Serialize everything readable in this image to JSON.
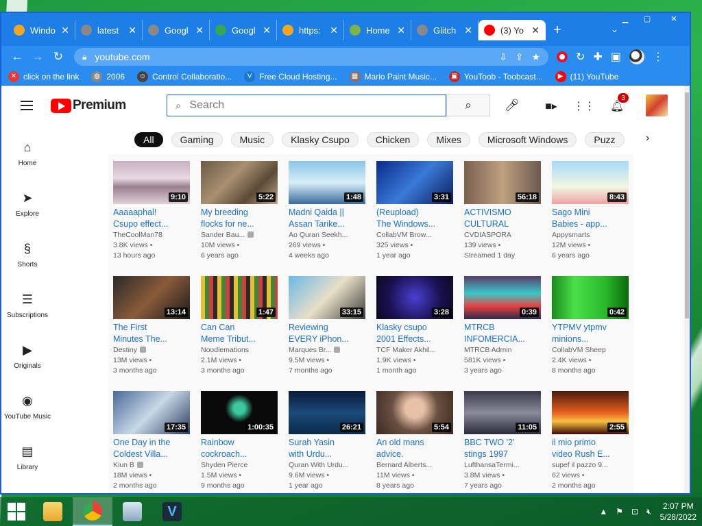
{
  "browser": {
    "tabs": [
      {
        "label": "Windo",
        "fav_color": "#f5a623",
        "active": false
      },
      {
        "label": "latest",
        "fav_color": "#888888",
        "active": false
      },
      {
        "label": "Googl",
        "fav_color": "#888888",
        "active": false
      },
      {
        "label": "Googl",
        "fav_color": "#34a853",
        "active": false
      },
      {
        "label": "https:",
        "fav_color": "#f5a623",
        "active": false
      },
      {
        "label": "Home",
        "fav_color": "#7cb342",
        "active": false
      },
      {
        "label": "Glitch",
        "fav_color": "#888888",
        "active": false
      },
      {
        "label": "(3) Yo",
        "fav_color": "#ff0000",
        "active": true
      }
    ],
    "new_tab": "+",
    "tab_menu": "⌄",
    "url": "youtube.com",
    "bookmarks": [
      {
        "label": "click on the link",
        "icon_color": "#e53935",
        "icon": "✕"
      },
      {
        "label": "2006",
        "icon_color": "#888888",
        "icon": "◍"
      },
      {
        "label": "Control Collaboratio...",
        "icon_color": "#444444",
        "icon": "☺"
      },
      {
        "label": "Free Cloud Hosting...",
        "icon_color": "#1976d2",
        "icon": "V"
      },
      {
        "label": "Mario Paint Music...",
        "icon_color": "#8d6e63",
        "icon": "▦"
      },
      {
        "label": "YouToob - Toobcast...",
        "icon_color": "#c62828",
        "icon": "▣"
      },
      {
        "label": "(11) YouTube",
        "icon_color": "#ff0000",
        "icon": "▶"
      }
    ]
  },
  "yt": {
    "logo_word": "Premium",
    "search_placeholder": "Search",
    "notifications": "3",
    "chips": [
      "All",
      "Gaming",
      "Music",
      "Klasky Csupo",
      "Chicken",
      "Mixes",
      "Microsoft Windows",
      "Puzz"
    ],
    "sidebar": [
      {
        "label": "Home",
        "icon": "⌂"
      },
      {
        "label": "Explore",
        "icon": "➤"
      },
      {
        "label": "Shorts",
        "icon": "§"
      },
      {
        "label": "Subscriptions",
        "icon": "☰"
      },
      {
        "label": "Originals",
        "icon": "▶"
      },
      {
        "label": "YouTube Music",
        "icon": "◉"
      },
      {
        "label": "Library",
        "icon": "▤"
      }
    ],
    "videos": [
      {
        "t1": "Aaaaaphal!",
        "t2": "Csupo effect...",
        "ch": "TheCoolMan78",
        "v": false,
        "views": "3.8K views •",
        "age": "13 hours ago",
        "dur": "9:10",
        "bg": "linear-gradient(180deg,#c8b0c0,#e8d8e0 40%,#9a8090 60%,#e0d0d8)"
      },
      {
        "t1": "My breeding",
        "t2": "flocks for ne...",
        "ch": "Sander Bau...",
        "v": true,
        "views": "10M views •",
        "age": "6 years ago",
        "dur": "5:22",
        "bg": "linear-gradient(135deg,#6b5a48,#a89070 40%,#5a4a38 70%,#c0a888)"
      },
      {
        "t1": "Madni Qaida ||",
        "t2": "Assan Tarike...",
        "ch": "Ao Quran Seekh...",
        "v": false,
        "views": "269 views •",
        "age": "4 weeks ago",
        "dur": "1:48",
        "bg": "linear-gradient(180deg,#8ac4e8,#d8eef8 50%,#3a6a9a)"
      },
      {
        "t1": "(Reupload)",
        "t2": "The Windows...",
        "ch": "CollabVM Brow...",
        "v": false,
        "views": "325 views •",
        "age": "1 year ago",
        "dur": "3:31",
        "bg": "linear-gradient(135deg,#0a2a8a,#3a7ad8 50%,#0a1a5a)"
      },
      {
        "t1": "ACTIVISMO",
        "t2": "CULTURAL",
        "ch": "CVDIASPORA",
        "v": false,
        "views": "139 views •",
        "age": "Streamed 1 day",
        "dur": "56:18",
        "bg": "linear-gradient(90deg,#7a6050,#c0a080 50%,#6a5a50)"
      },
      {
        "t1": "Sago Mini",
        "t2": "Babies - app...",
        "ch": "Appysmarts",
        "v": false,
        "views": "12M views •",
        "age": "6 years ago",
        "dur": "8:43",
        "bg": "linear-gradient(180deg,#a8d8f8,#f0f8e0 60%,#f0a0a0)"
      },
      {
        "t1": "The First",
        "t2": "Minutes The...",
        "ch": "Destiny",
        "v": true,
        "views": "13M views •",
        "age": "3 months ago",
        "dur": "13:14",
        "bg": "linear-gradient(135deg,#2a2a2a,#8a5a3a 50%,#1a1a1a)"
      },
      {
        "t1": "Can Can",
        "t2": "Meme Tribut...",
        "ch": "Noodlemations",
        "v": false,
        "views": "2.1M views •",
        "age": "3 months ago",
        "dur": "1:47",
        "bg": "repeating-linear-gradient(90deg,#e8c030 0 6px,#3a8a3a 6px 12px,#d04040 12px 18px,#2a2a2a 18px 24px)"
      },
      {
        "t1": "Reviewing",
        "t2": "EVERY iPhon...",
        "ch": "Marques Br...",
        "v": true,
        "views": "9.5M views •",
        "age": "7 months ago",
        "dur": "33:15",
        "bg": "linear-gradient(135deg,#6ab8e8,#e8e0c8 50%,#3a3a3a)"
      },
      {
        "t1": "Klasky csupo",
        "t2": "2001 Effects...",
        "ch": "TCF Maker Akhil...",
        "v": false,
        "views": "1.9K views •",
        "age": "1 month ago",
        "dur": "3:28",
        "bg": "radial-gradient(circle,#4a40d0,#1a1050 60%,#0a0a20)"
      },
      {
        "t1": "MTRCB",
        "t2": "INFOMERCIA...",
        "ch": "MTRCB Admin",
        "v": false,
        "views": "581K views •",
        "age": "3 years ago",
        "dur": "0:39",
        "bg": "linear-gradient(180deg,#5a3a6a,#3ac8c8 40%,#e84040 70%,#2a2a4a)"
      },
      {
        "t1": "YTPMV ytpmv",
        "t2": "minions...",
        "ch": "CollabVM Sheep",
        "v": false,
        "views": "2.4K views •",
        "age": "8 months ago",
        "dur": "0:42",
        "bg": "linear-gradient(90deg,#1a8a1a,#4ae04a 30%,#2ab82a 70%,#0a6a0a)"
      },
      {
        "t1": "One Day in the",
        "t2": "Coldest Villa...",
        "ch": "Kiun B",
        "v": true,
        "views": "18M views •",
        "age": "2 months ago",
        "dur": "17:35",
        "bg": "linear-gradient(135deg,#4a6a9a,#c8d8e8 50%,#2a3a5a)"
      },
      {
        "t1": "Rainbow",
        "t2": "cockroach...",
        "ch": "Shyden Pierce",
        "v": false,
        "views": "1.5M views •",
        "age": "9 months ago",
        "dur": "1:00:35",
        "bg": "radial-gradient(circle at 50% 40%,#3ac8a0 0 12%,#0a0a0a 30%)"
      },
      {
        "t1": "Surah Yasin",
        "t2": "with Urdu...",
        "ch": "Quran With Urdu...",
        "v": false,
        "views": "9.6M views •",
        "age": "1 year ago",
        "dur": "26:21",
        "bg": "linear-gradient(180deg,#0a1a3a,#1a4a7a 50%,#0a2a4a)"
      },
      {
        "t1": "An old mans",
        "t2": "advice.",
        "ch": "Bernard Alberts...",
        "v": false,
        "views": "11M views •",
        "age": "8 years ago",
        "dur": "5:54",
        "bg": "radial-gradient(circle at 50% 40%,#e8c0a8 0 20%,#6a5040 50%,#3a2a20)"
      },
      {
        "t1": "BBC TWO '2'",
        "t2": "stings 1997",
        "ch": "LufthansaTermi...",
        "v": false,
        "views": "3.8M views •",
        "age": "7 years ago",
        "dur": "11:05",
        "bg": "linear-gradient(180deg,#3a3a4a,#8a8a9a 50%,#2a2a3a)"
      },
      {
        "t1": "il mio primo",
        "t2": "video Rush E...",
        "ch": "supef il pazzo 9...",
        "v": false,
        "views": "62 views •",
        "age": "2 months ago",
        "dur": "2:55",
        "bg": "linear-gradient(180deg,#4a1a0a,#e86020 50%,#f8c040 70%,#3a0a0a)"
      }
    ]
  },
  "taskbar": {
    "time": "2:07 PM",
    "date": "5/28/2022"
  }
}
